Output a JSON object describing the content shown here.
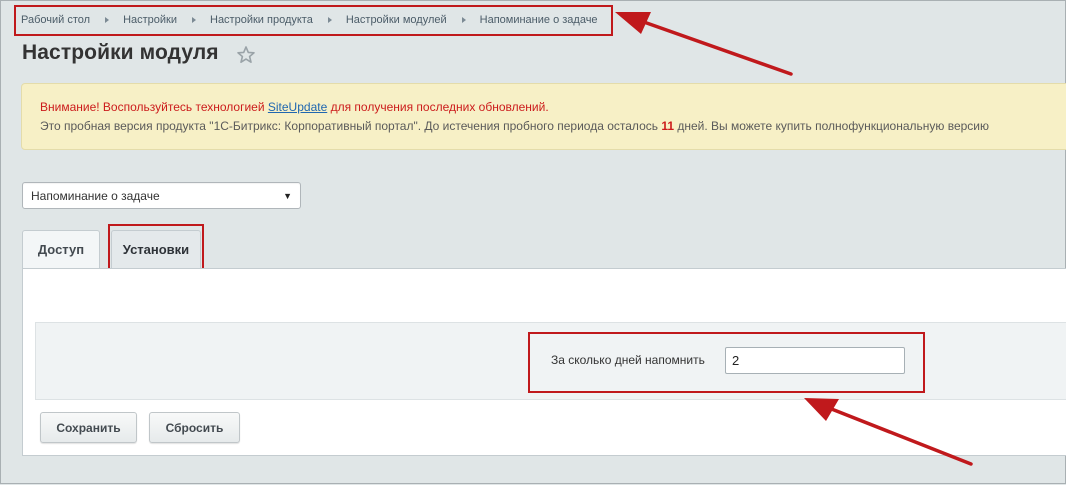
{
  "breadcrumb": {
    "items": [
      "Рабочий стол",
      "Настройки",
      "Настройки продукта",
      "Настройки модулей",
      "Напоминание о задаче"
    ]
  },
  "page": {
    "title": "Настройки модуля"
  },
  "notice": {
    "line1_before": "Внимание! Воспользуйтесь технологией ",
    "line1_link": "SiteUpdate",
    "line1_after": " для получения последних обновлений.",
    "line2_before": "Это пробная версия продукта \"1С-Битрикс: Корпоративный портал\". До истечения пробного периода осталось ",
    "line2_days": "11",
    "line2_after": " дней. Вы можете купить полнофункциональную версию"
  },
  "module_select": {
    "value": "Напоминание о задаче"
  },
  "tabs": [
    {
      "label": "Доступ"
    },
    {
      "label": "Установки"
    }
  ],
  "form": {
    "days_label": "За сколько дней напомнить",
    "days_value": "2"
  },
  "buttons": {
    "save": "Сохранить",
    "reset": "Сбросить"
  },
  "colors": {
    "annotation": "#c0191c",
    "warning_text": "#cc1c1c",
    "link": "#2067b0"
  }
}
